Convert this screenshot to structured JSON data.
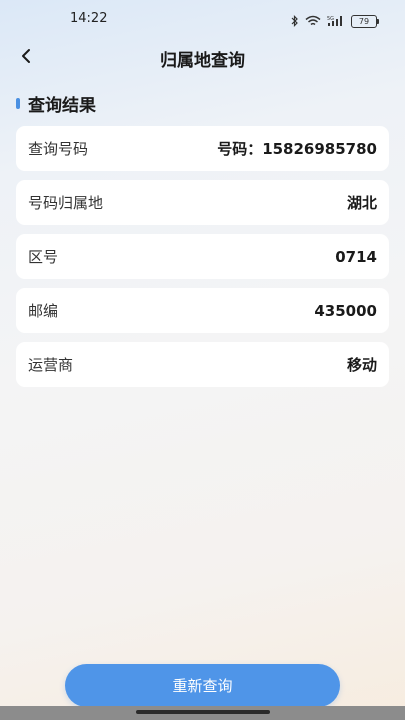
{
  "status_bar": {
    "time": "14:22",
    "battery": "79",
    "icons": [
      "bluetooth-icon",
      "wifi-icon",
      "signal-5g-icon",
      "battery-icon"
    ]
  },
  "nav": {
    "title": "归属地查询",
    "back_icon": "chevron-left-icon"
  },
  "section": {
    "title": "查询结果",
    "accent_color": "#4a90e2"
  },
  "results": [
    {
      "label": "查询号码",
      "value": "号码：15826985780"
    },
    {
      "label": "号码归属地",
      "value": "湖北"
    },
    {
      "label": "区号",
      "value": "0714"
    },
    {
      "label": "邮编",
      "value": "435000"
    },
    {
      "label": "运营商",
      "value": "移动"
    }
  ],
  "actions": {
    "requery_label": "重新查询",
    "button_color": "#4f95e8"
  }
}
